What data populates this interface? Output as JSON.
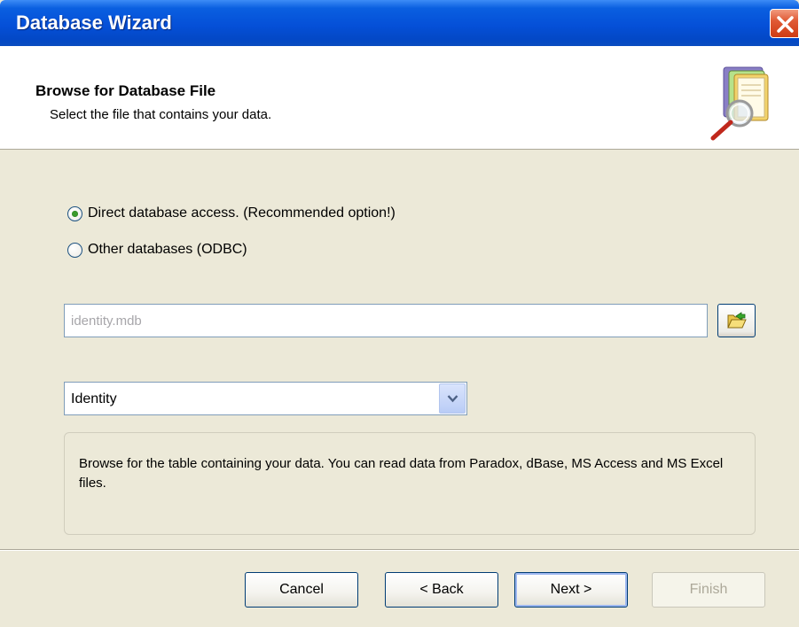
{
  "window": {
    "title": "Database Wizard",
    "close_icon": "close-icon"
  },
  "header": {
    "title": "Browse for Database File",
    "subtitle": "Select the file that contains your data.",
    "icon": "database-search-icon"
  },
  "options": {
    "direct_label": "Direct database access. (Recommended option!)",
    "direct_selected": true,
    "odbc_label": "Other databases (ODBC)",
    "odbc_selected": false
  },
  "file": {
    "value": "identity.mdb",
    "browse_icon": "open-folder-icon"
  },
  "table": {
    "selected": "Identity"
  },
  "info": {
    "text": "Browse for the table containing your data. You can read data from Paradox, dBase, MS Access and MS Excel files."
  },
  "buttons": {
    "cancel": "Cancel",
    "back": "< Back",
    "next": "Next >",
    "finish": "Finish"
  },
  "colors": {
    "titlebar": "#0550d8",
    "dialog_bg": "#ece9d8",
    "radio_dot": "#3a9a2a",
    "close_red": "#cf3b12"
  }
}
